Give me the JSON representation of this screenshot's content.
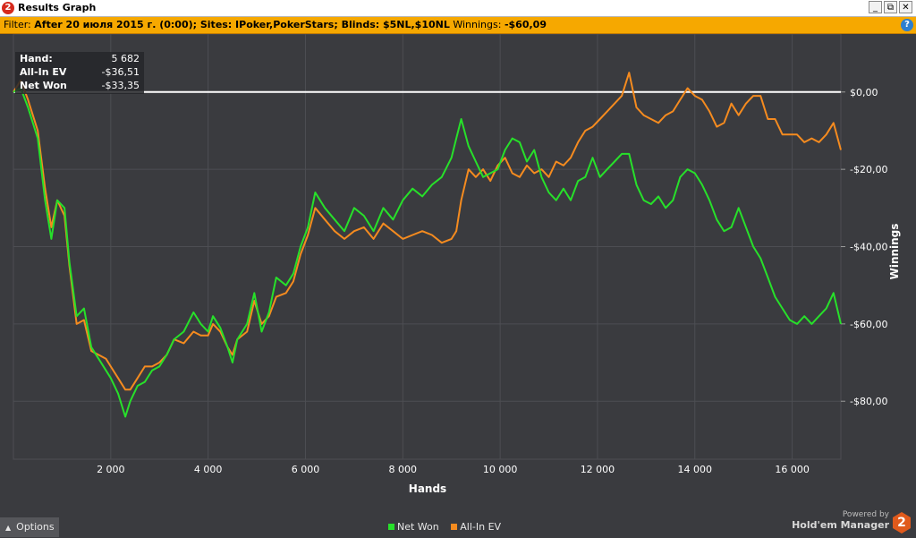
{
  "window": {
    "title": "Results Graph",
    "app_icon": "2",
    "controls": {
      "minimize": "_",
      "restore": "⧉",
      "close": "✕"
    }
  },
  "filter": {
    "label": "Filter:",
    "text": "After 20 июля 2015 г. (0:00); Sites: IPoker,PokerStars; Blinds: $5NL,$10NL",
    "winnings_label": "Winnings:",
    "winnings_value": "-$60,09"
  },
  "info_box": {
    "rows": [
      {
        "label": "Hand:",
        "value": "5 682"
      },
      {
        "label": "All-In EV",
        "value": "-$36,51"
      },
      {
        "label": "Net Won",
        "value": "-$33,35"
      }
    ]
  },
  "bottom": {
    "options_label": "Options",
    "powered_by": "Powered by",
    "product": "Hold'em Manager",
    "logo_text": "2"
  },
  "colors": {
    "background": "#3a3b3f",
    "grid": "#4d4e53",
    "zero_line": "#ffffff",
    "net_won": "#27e02a",
    "all_in_ev": "#f58b1f"
  },
  "chart_data": {
    "type": "line",
    "xlabel": "Hands",
    "ylabel": "Winnings",
    "xlim": [
      0,
      17000
    ],
    "ylim": [
      -95,
      15
    ],
    "x_ticks": [
      2000,
      4000,
      6000,
      8000,
      10000,
      12000,
      14000,
      16000
    ],
    "x_tick_labels": [
      "2 000",
      "4 000",
      "6 000",
      "8 000",
      "10 000",
      "12 000",
      "14 000",
      "16 000"
    ],
    "y_ticks": [
      0,
      -20,
      -40,
      -60,
      -80
    ],
    "y_tick_labels": [
      "$0,00",
      "-$20,00",
      "-$40,00",
      "-$60,00",
      "-$80,00"
    ],
    "grid": true,
    "legend_position": "bottom-center",
    "series": [
      {
        "name": "Net Won",
        "color": "#27e02a",
        "points": [
          [
            0,
            0
          ],
          [
            150,
            1
          ],
          [
            300,
            -4
          ],
          [
            500,
            -12
          ],
          [
            650,
            -28
          ],
          [
            780,
            -38
          ],
          [
            900,
            -28
          ],
          [
            1050,
            -30
          ],
          [
            1150,
            -44
          ],
          [
            1300,
            -58
          ],
          [
            1450,
            -56
          ],
          [
            1600,
            -66
          ],
          [
            1750,
            -69
          ],
          [
            1900,
            -72
          ],
          [
            2000,
            -74
          ],
          [
            2150,
            -78
          ],
          [
            2300,
            -84
          ],
          [
            2400,
            -80
          ],
          [
            2550,
            -76
          ],
          [
            2700,
            -75
          ],
          [
            2850,
            -72
          ],
          [
            3000,
            -71
          ],
          [
            3150,
            -68
          ],
          [
            3300,
            -64
          ],
          [
            3500,
            -62
          ],
          [
            3700,
            -57
          ],
          [
            3850,
            -60
          ],
          [
            4000,
            -62
          ],
          [
            4100,
            -58
          ],
          [
            4250,
            -61
          ],
          [
            4400,
            -66
          ],
          [
            4500,
            -70
          ],
          [
            4600,
            -64
          ],
          [
            4800,
            -60
          ],
          [
            4950,
            -52
          ],
          [
            5100,
            -62
          ],
          [
            5250,
            -57
          ],
          [
            5400,
            -48
          ],
          [
            5600,
            -50
          ],
          [
            5750,
            -47
          ],
          [
            5900,
            -40
          ],
          [
            6050,
            -35
          ],
          [
            6200,
            -26
          ],
          [
            6400,
            -30
          ],
          [
            6600,
            -33
          ],
          [
            6800,
            -36
          ],
          [
            7000,
            -30
          ],
          [
            7200,
            -32
          ],
          [
            7400,
            -36
          ],
          [
            7600,
            -30
          ],
          [
            7800,
            -33
          ],
          [
            8000,
            -28
          ],
          [
            8200,
            -25
          ],
          [
            8400,
            -27
          ],
          [
            8600,
            -24
          ],
          [
            8800,
            -22
          ],
          [
            9000,
            -17
          ],
          [
            9100,
            -12
          ],
          [
            9200,
            -7
          ],
          [
            9350,
            -14
          ],
          [
            9500,
            -18
          ],
          [
            9650,
            -22
          ],
          [
            9800,
            -21
          ],
          [
            9950,
            -20
          ],
          [
            10100,
            -15
          ],
          [
            10250,
            -12
          ],
          [
            10400,
            -13
          ],
          [
            10550,
            -18
          ],
          [
            10700,
            -15
          ],
          [
            10850,
            -22
          ],
          [
            11000,
            -26
          ],
          [
            11150,
            -28
          ],
          [
            11300,
            -25
          ],
          [
            11450,
            -28
          ],
          [
            11600,
            -23
          ],
          [
            11750,
            -22
          ],
          [
            11900,
            -17
          ],
          [
            12050,
            -22
          ],
          [
            12200,
            -20
          ],
          [
            12350,
            -18
          ],
          [
            12500,
            -16
          ],
          [
            12650,
            -16
          ],
          [
            12800,
            -24
          ],
          [
            12950,
            -28
          ],
          [
            13100,
            -29
          ],
          [
            13250,
            -27
          ],
          [
            13400,
            -30
          ],
          [
            13550,
            -28
          ],
          [
            13700,
            -22
          ],
          [
            13850,
            -20
          ],
          [
            14000,
            -21
          ],
          [
            14150,
            -24
          ],
          [
            14300,
            -28
          ],
          [
            14450,
            -33
          ],
          [
            14600,
            -36
          ],
          [
            14750,
            -35
          ],
          [
            14900,
            -30
          ],
          [
            15050,
            -35
          ],
          [
            15200,
            -40
          ],
          [
            15350,
            -43
          ],
          [
            15500,
            -48
          ],
          [
            15650,
            -53
          ],
          [
            15800,
            -56
          ],
          [
            15950,
            -59
          ],
          [
            16100,
            -60
          ],
          [
            16250,
            -58
          ],
          [
            16400,
            -60
          ],
          [
            16550,
            -58
          ],
          [
            16700,
            -56
          ],
          [
            16850,
            -52
          ],
          [
            17000,
            -60
          ]
        ]
      },
      {
        "name": "All-In EV",
        "color": "#f58b1f",
        "points": [
          [
            0,
            0
          ],
          [
            150,
            3
          ],
          [
            300,
            -2
          ],
          [
            500,
            -10
          ],
          [
            650,
            -25
          ],
          [
            780,
            -35
          ],
          [
            900,
            -28
          ],
          [
            1050,
            -32
          ],
          [
            1150,
            -45
          ],
          [
            1300,
            -60
          ],
          [
            1450,
            -59
          ],
          [
            1600,
            -67
          ],
          [
            1750,
            -68
          ],
          [
            1900,
            -69
          ],
          [
            2000,
            -71
          ],
          [
            2150,
            -74
          ],
          [
            2300,
            -77
          ],
          [
            2400,
            -77
          ],
          [
            2550,
            -74
          ],
          [
            2700,
            -71
          ],
          [
            2850,
            -71
          ],
          [
            3000,
            -70
          ],
          [
            3150,
            -68
          ],
          [
            3300,
            -64
          ],
          [
            3500,
            -65
          ],
          [
            3700,
            -62
          ],
          [
            3850,
            -63
          ],
          [
            4000,
            -63
          ],
          [
            4100,
            -60
          ],
          [
            4250,
            -62
          ],
          [
            4400,
            -66
          ],
          [
            4500,
            -68
          ],
          [
            4600,
            -64
          ],
          [
            4800,
            -62
          ],
          [
            4950,
            -54
          ],
          [
            5100,
            -60
          ],
          [
            5250,
            -58
          ],
          [
            5400,
            -53
          ],
          [
            5600,
            -52
          ],
          [
            5750,
            -49
          ],
          [
            5900,
            -42
          ],
          [
            6050,
            -37
          ],
          [
            6200,
            -30
          ],
          [
            6400,
            -33
          ],
          [
            6600,
            -36
          ],
          [
            6800,
            -38
          ],
          [
            7000,
            -36
          ],
          [
            7200,
            -35
          ],
          [
            7400,
            -38
          ],
          [
            7600,
            -34
          ],
          [
            7800,
            -36
          ],
          [
            8000,
            -38
          ],
          [
            8200,
            -37
          ],
          [
            8400,
            -36
          ],
          [
            8600,
            -37
          ],
          [
            8800,
            -39
          ],
          [
            9000,
            -38
          ],
          [
            9100,
            -36
          ],
          [
            9200,
            -28
          ],
          [
            9350,
            -20
          ],
          [
            9500,
            -22
          ],
          [
            9650,
            -20
          ],
          [
            9800,
            -23
          ],
          [
            9950,
            -19
          ],
          [
            10100,
            -17
          ],
          [
            10250,
            -21
          ],
          [
            10400,
            -22
          ],
          [
            10550,
            -19
          ],
          [
            10700,
            -21
          ],
          [
            10850,
            -20
          ],
          [
            11000,
            -22
          ],
          [
            11150,
            -18
          ],
          [
            11300,
            -19
          ],
          [
            11450,
            -17
          ],
          [
            11600,
            -13
          ],
          [
            11750,
            -10
          ],
          [
            11900,
            -9
          ],
          [
            12050,
            -7
          ],
          [
            12200,
            -5
          ],
          [
            12350,
            -3
          ],
          [
            12500,
            -1
          ],
          [
            12650,
            5
          ],
          [
            12800,
            -4
          ],
          [
            12950,
            -6
          ],
          [
            13100,
            -7
          ],
          [
            13250,
            -8
          ],
          [
            13400,
            -6
          ],
          [
            13550,
            -5
          ],
          [
            13700,
            -2
          ],
          [
            13850,
            1
          ],
          [
            14000,
            -1
          ],
          [
            14150,
            -2
          ],
          [
            14300,
            -5
          ],
          [
            14450,
            -9
          ],
          [
            14600,
            -8
          ],
          [
            14750,
            -3
          ],
          [
            14900,
            -6
          ],
          [
            15050,
            -3
          ],
          [
            15200,
            -1
          ],
          [
            15350,
            -1
          ],
          [
            15500,
            -7
          ],
          [
            15650,
            -7
          ],
          [
            15800,
            -11
          ],
          [
            15950,
            -11
          ],
          [
            16100,
            -11
          ],
          [
            16250,
            -13
          ],
          [
            16400,
            -12
          ],
          [
            16550,
            -13
          ],
          [
            16700,
            -11
          ],
          [
            16850,
            -8
          ],
          [
            17000,
            -15
          ]
        ]
      }
    ]
  }
}
